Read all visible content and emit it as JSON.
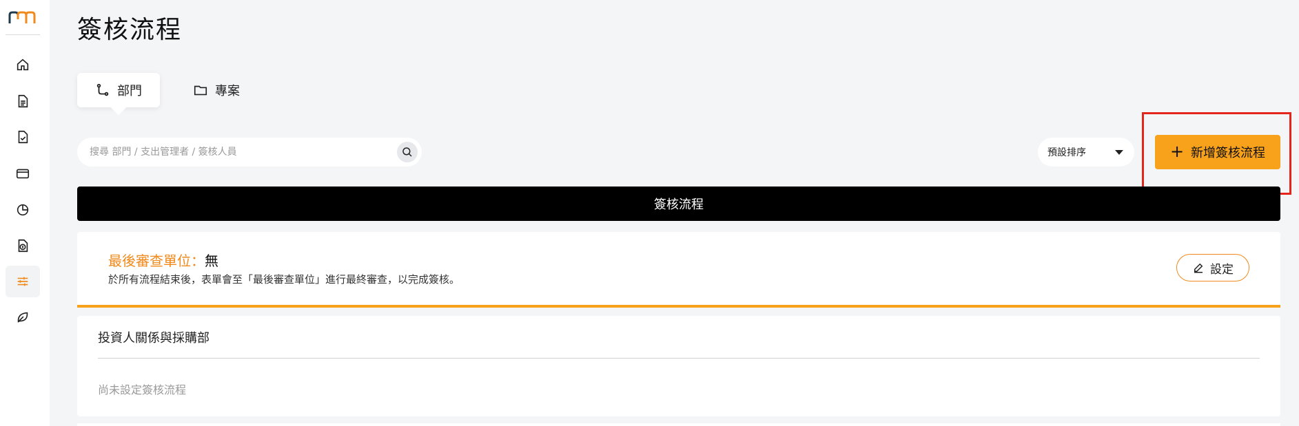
{
  "sidebar": {
    "logo": "logo-icon",
    "items": [
      {
        "name": "home-icon"
      },
      {
        "name": "document-icon"
      },
      {
        "name": "approval-document-icon"
      },
      {
        "name": "wallet-icon"
      },
      {
        "name": "pie-chart-icon"
      },
      {
        "name": "money-document-icon"
      },
      {
        "name": "sliders-icon",
        "active": true
      },
      {
        "name": "leaf-icon"
      }
    ]
  },
  "page": {
    "title": "簽核流程"
  },
  "tabs": [
    {
      "label": "部門",
      "icon": "branch-icon",
      "active": true
    },
    {
      "label": "專案",
      "icon": "folder-icon",
      "active": false
    }
  ],
  "search": {
    "placeholder": "搜尋 部門 / 支出管理者 / 簽核人員",
    "value": ""
  },
  "sort": {
    "label": "預設排序"
  },
  "add_button": {
    "label": "新增簽核流程"
  },
  "table": {
    "header": "簽核流程"
  },
  "final_review": {
    "label": "最後審查單位：",
    "value": "無",
    "description": "於所有流程結束後，表單會至「最後審查單位」進行最終審查，以完成簽核。",
    "button": "設定"
  },
  "departments": [
    {
      "name": "投資人關係與採購部",
      "status": "尚未設定簽核流程"
    }
  ],
  "colors": {
    "accent": "#f8a11b",
    "label_orange": "#f08a1c",
    "highlight": "#e3251b",
    "header_bg": "#000000"
  }
}
